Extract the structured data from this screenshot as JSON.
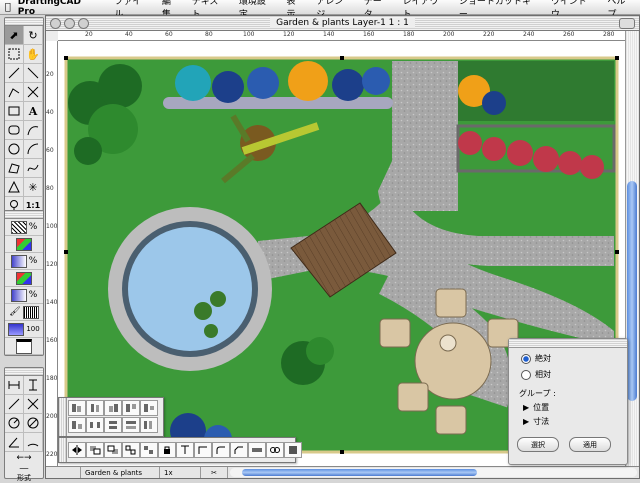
{
  "menubar": {
    "app_name": "DraftingCAD Pro",
    "items": [
      "ファイル",
      "編集",
      "テキスト",
      "環境設定",
      "表示",
      "アレンジ",
      "データ",
      "レイアウト",
      "ショートカットキー",
      "ウインドウ",
      "ヘルプ"
    ]
  },
  "tools": {
    "letter_a": "A",
    "percent": "%",
    "zoom_value": "100",
    "scale_label": "1:1",
    "form_label": "形式"
  },
  "window": {
    "title": "Garden & plants Layer-1 1 : 1",
    "ruler_top": [
      "20",
      "40",
      "60",
      "80",
      "100",
      "120",
      "140",
      "160",
      "180",
      "200",
      "220",
      "240",
      "260",
      "280"
    ],
    "ruler_left": [
      "20",
      "40",
      "60",
      "80",
      "100",
      "120",
      "140",
      "160",
      "180",
      "200",
      "220"
    ]
  },
  "statusbar": {
    "layer_name": "Garden & plants",
    "zoom": "1x"
  },
  "panel": {
    "radio_absolute": "絶対",
    "radio_relative": "相対",
    "group_label": "グループ :",
    "position": "位置",
    "dimensions": "寸法",
    "select_button": "選択",
    "apply_button": "適用"
  },
  "colors": {
    "lawn": "#3d9a3a",
    "path": "#a9a9a9",
    "water": "#9cc7ea",
    "deck": "#7a5a3c",
    "furniture": "#d9c6a4",
    "scroll_accent": "#5d8fe0"
  }
}
